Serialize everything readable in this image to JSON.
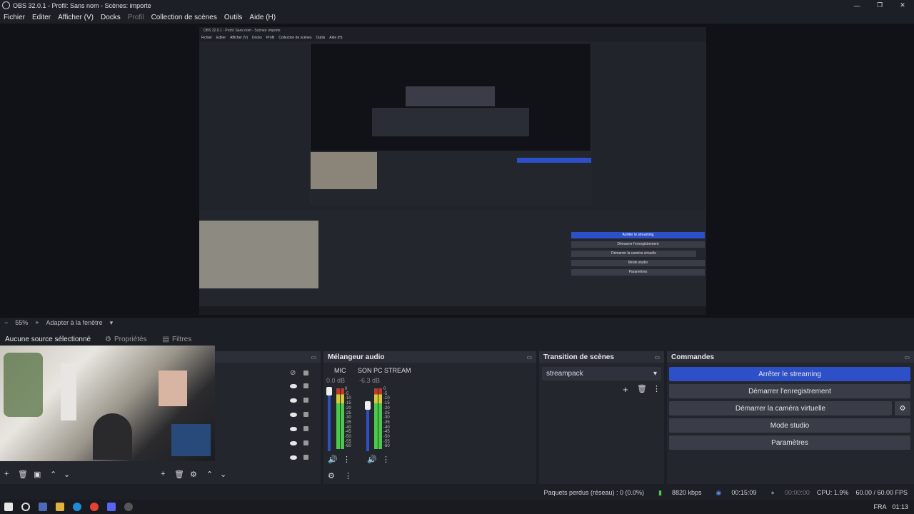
{
  "window": {
    "title": "OBS 32.0.1 - Profil: Sans nom - Scènes: importe"
  },
  "menu": [
    "Fichier",
    "Editer",
    "Afficher (V)",
    "Docks",
    "Profil",
    "Collection de scènes",
    "Outils",
    "Aide (H)"
  ],
  "zoom": {
    "minus": "−",
    "value": "55%",
    "plus": "+",
    "fit": "Adapter à la fenêtre"
  },
  "source_bar": {
    "no_selection": "Aucune source sélectionné",
    "properties": "Propriétés",
    "filters": "Filtres"
  },
  "mixer": {
    "title": "Mélangeur audio",
    "channels": [
      {
        "name": "MIC",
        "db": "0.0 dB",
        "level": 0.55
      },
      {
        "name": "SON PC STREAM",
        "db": "-6.3 dB",
        "level": 0.62
      }
    ],
    "scale": [
      "0",
      "-5",
      "-10",
      "-15",
      "-20",
      "-25",
      "-30",
      "-35",
      "-40",
      "-45",
      "-50",
      "-55",
      "-60"
    ]
  },
  "transition": {
    "title": "Transition de scènes",
    "selected": "streampack"
  },
  "commands": {
    "title": "Commandes",
    "stop_stream": "Arrêter le streaming",
    "start_record": "Démarrer l'enregistrement",
    "start_vcam": "Démarrer la caméra virtuelle",
    "studio": "Mode studio",
    "settings": "Paramètres"
  },
  "status": {
    "dropped": "Paquets perdus (réseau) : 0 (0.0%)",
    "bitrate": "8820 kbps",
    "stream_time": "00:15:09",
    "rec_time": "00:00:00",
    "cpu": "CPU: 1.9%",
    "fps": "60.00 / 60.00 FPS"
  },
  "taskbar": {
    "lang": "FRA",
    "time": "01:13"
  },
  "colors": {
    "accent": "#2d4fc7",
    "meter_green": "#4cc94c",
    "meter_yellow": "#d6c93a",
    "meter_red": "#c0392b"
  }
}
